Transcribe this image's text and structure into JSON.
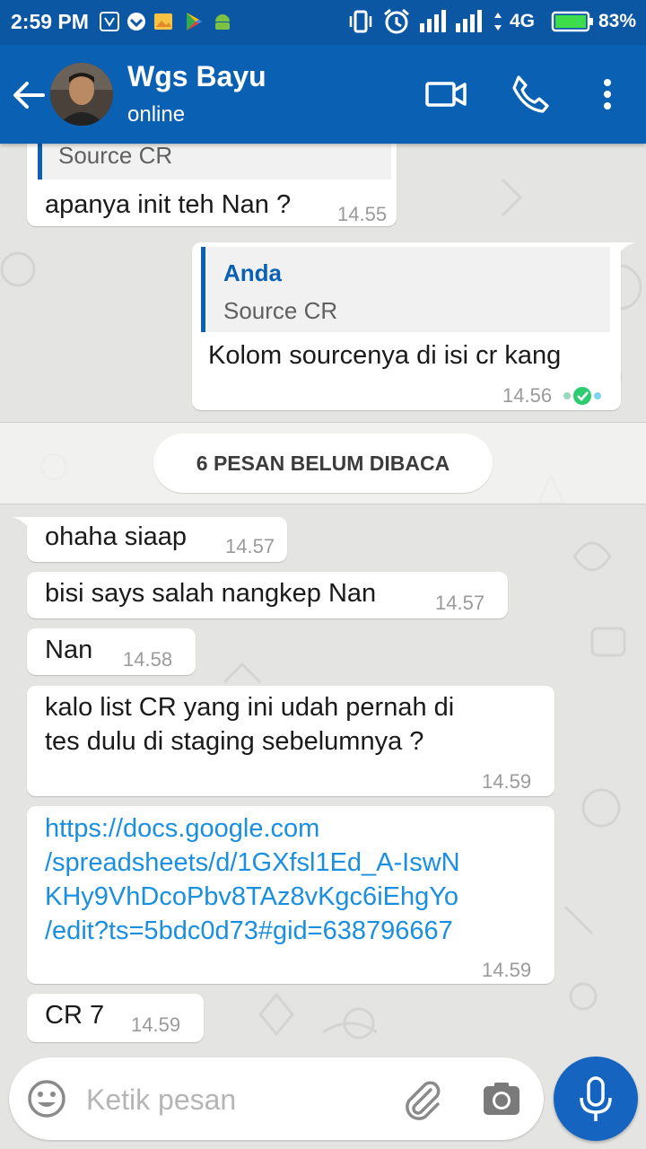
{
  "status_bar": {
    "time": "2:59 PM",
    "network": "4G",
    "battery": "83%",
    "battery_level": 0.83,
    "notification_icons": [
      "vpn-icon",
      "app-icon",
      "photo-icon",
      "play-store-icon",
      "android-debug-icon"
    ]
  },
  "header": {
    "contact_name": "Wgs Bayu",
    "contact_status": "online",
    "color": "#0a60b3"
  },
  "messages": [
    {
      "direction": "incoming",
      "quote": {
        "text": "Source CR"
      },
      "text": "apanya init teh Nan ?",
      "time": "14.55"
    },
    {
      "direction": "outgoing",
      "quote": {
        "author": "Anda",
        "text": "Source CR"
      },
      "text": "Kolom sourcenya di isi cr kang",
      "time": "14.56",
      "status": "read"
    },
    {
      "direction": "incoming",
      "text": "ohaha siaap",
      "time": "14.57"
    },
    {
      "direction": "incoming",
      "text": "bisi says salah nangkep Nan",
      "time": "14.57"
    },
    {
      "direction": "incoming",
      "text": "Nan",
      "time": "14.58"
    },
    {
      "direction": "incoming",
      "lines": [
        "kalo list CR yang ini udah pernah di",
        "tes dulu di staging sebelumnya ?"
      ],
      "time": "14.59"
    },
    {
      "direction": "incoming",
      "link_lines": [
        "https://docs.google.com",
        "/spreadsheets/d/1GXfsl1Ed_A-IswN",
        "KHy9VhDcoPbv8TAz8vKgc6iEhgYo",
        "/edit?ts=5bdc0d73#gid=638796667"
      ],
      "time": "14.59"
    },
    {
      "direction": "incoming",
      "text": "CR 7",
      "time": "14.59"
    }
  ],
  "unread_divider": "6 PESAN BELUM DIBACA",
  "composer": {
    "placeholder": "Ketik pesan",
    "value": ""
  },
  "colors": {
    "link": "#1a8fe0",
    "read_tick": "#2ecc71",
    "mic_button": "#1565c0"
  }
}
